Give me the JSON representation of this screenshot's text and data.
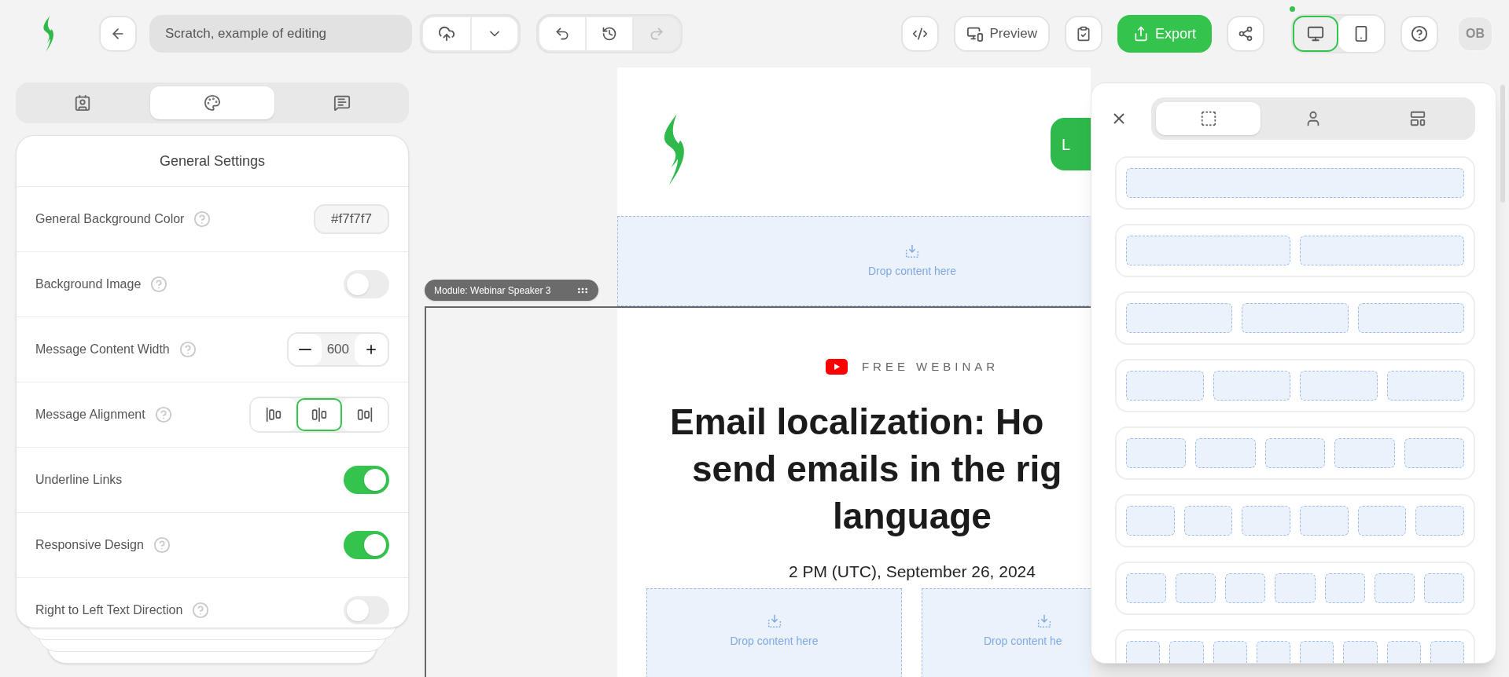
{
  "toolbar": {
    "document_title": "Scratch, example of editing",
    "history": [
      {
        "kind": "undo",
        "disabled": false
      },
      {
        "kind": "history",
        "disabled": false
      },
      {
        "kind": "redo",
        "disabled": true
      }
    ],
    "preview": "Preview",
    "export": "Export",
    "avatar": "OB",
    "views": [
      {
        "kind": "desktop",
        "selected": true
      },
      {
        "kind": "mobile",
        "selected": false
      }
    ]
  },
  "left_tabs": [
    {
      "kind": "content",
      "selected": false
    },
    {
      "kind": "appearance",
      "selected": true
    },
    {
      "kind": "comments",
      "selected": false
    }
  ],
  "settings": {
    "title": "General Settings",
    "rows": [
      {
        "label": "General Background Color",
        "help": true,
        "kind": "color",
        "value": "#f7f7f7"
      },
      {
        "label": "Background Image",
        "help": true,
        "kind": "toggle",
        "on": false
      },
      {
        "label": "Message Content Width",
        "help": true,
        "kind": "stepper",
        "value": "600"
      },
      {
        "label": "Message Alignment",
        "help": true,
        "kind": "alignment",
        "options": [
          {
            "kind": "left",
            "selected": false
          },
          {
            "kind": "center",
            "selected": true
          },
          {
            "kind": "right",
            "selected": false
          }
        ]
      },
      {
        "label": "Underline Links",
        "help": false,
        "kind": "toggle",
        "on": true
      },
      {
        "label": "Responsive Design",
        "help": true,
        "kind": "toggle",
        "on": true
      },
      {
        "label": "Right to Left Text Direction",
        "help": true,
        "kind": "toggle",
        "on": false
      }
    ]
  },
  "canvas": {
    "header_button": "L",
    "top_drop": "Drop content here",
    "module_label": "Module: Webinar Speaker 3",
    "eyebrow": "FREE WEBINAR",
    "title_lines": [
      "Email localization: Ho",
      "send emails in the rig",
      "language"
    ],
    "date": "2 PM (UTC), September 26, 2024",
    "drops": [
      "Drop content here",
      "Drop content he"
    ]
  },
  "blocks_panel": {
    "tabs": [
      {
        "kind": "layouts",
        "selected": true
      },
      {
        "kind": "person",
        "selected": false
      },
      {
        "kind": "modules",
        "selected": false
      }
    ],
    "layouts": [
      {
        "kind": "cols-1"
      },
      {
        "kind": "cols-2"
      },
      {
        "kind": "cols-3"
      },
      {
        "kind": "cols-4"
      },
      {
        "kind": "cols-5"
      },
      {
        "kind": "cols-6"
      },
      {
        "kind": "cols-7"
      },
      {
        "kind": "cols-8"
      }
    ]
  }
}
